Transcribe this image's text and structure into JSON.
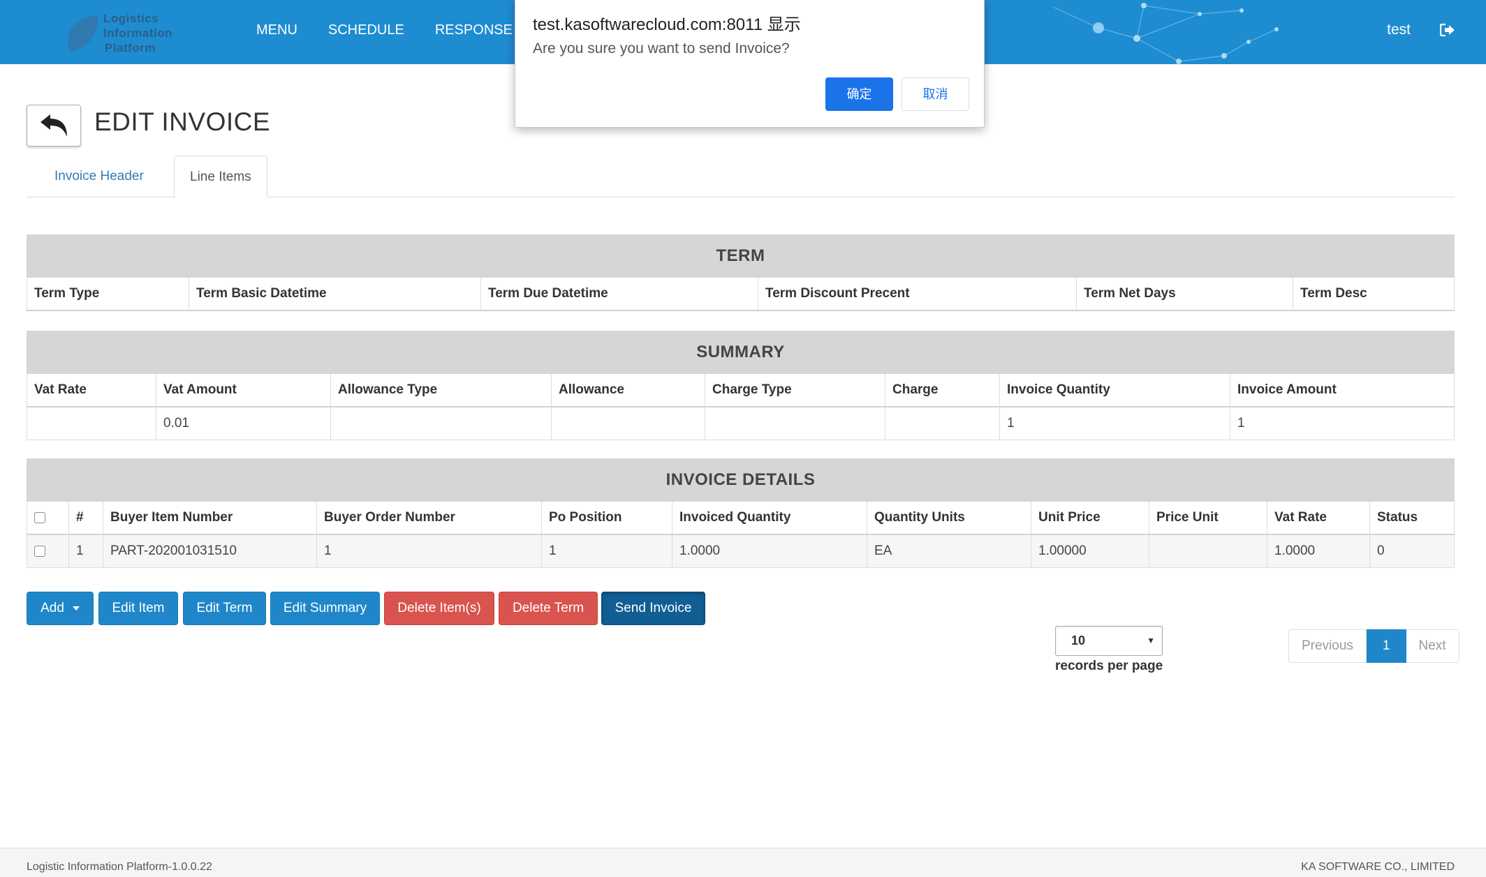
{
  "navbar": {
    "logo_lines": [
      "Logistics",
      "Information",
      "Platform"
    ],
    "menu": [
      "MENU",
      "SCHEDULE",
      "RESPONSE"
    ],
    "user": "test",
    "color": "#1e8cd0"
  },
  "page": {
    "title": "EDIT INVOICE",
    "tabs": [
      "Invoice Header",
      "Line Items"
    ],
    "active_tab": "Line Items"
  },
  "term_table": {
    "caption": "TERM",
    "columns": [
      "Term Type",
      "Term Basic Datetime",
      "Term Due Datetime",
      "Term Discount Precent",
      "Term Net Days",
      "Term Desc"
    ]
  },
  "summary_table": {
    "caption": "SUMMARY",
    "columns": [
      "Vat Rate",
      "Vat Amount",
      "Allowance Type",
      "Allowance",
      "Charge Type",
      "Charge",
      "Invoice Quantity",
      "Invoice Amount"
    ],
    "row": [
      "",
      "0.01",
      "",
      "",
      "",
      "",
      "1",
      "1"
    ]
  },
  "details_table": {
    "caption": "INVOICE DETAILS",
    "columns": [
      "",
      "#",
      "Buyer Item Number",
      "Buyer Order Number",
      "Po Position",
      "Invoiced Quantity",
      "Quantity Units",
      "Unit Price",
      "Price Unit",
      "Vat Rate",
      "Status"
    ],
    "rows": [
      [
        "",
        "1",
        "PART-202001031510",
        "1",
        "1",
        "1.0000",
        "EA",
        "1.00000",
        "",
        "1.0000",
        "0"
      ]
    ]
  },
  "actions": {
    "add": "Add",
    "edit_item": "Edit Item",
    "edit_term": "Edit Term",
    "edit_summary": "Edit Summary",
    "delete_items": "Delete Item(s)",
    "delete_term": "Delete Term",
    "send_invoice": "Send Invoice"
  },
  "pagination": {
    "records_per_page_value": "10",
    "records_per_page_label": "records per page",
    "previous": "Previous",
    "current": "1",
    "next": "Next"
  },
  "footer": {
    "left": "Logistic Information Platform-1.0.0.22",
    "right": "KA SOFTWARE CO., LIMITED"
  },
  "dialog": {
    "title": "test.kasoftwarecloud.com:8011 显示",
    "message": "Are you sure you want to send Invoice?",
    "ok": "确定",
    "cancel": "取消"
  }
}
